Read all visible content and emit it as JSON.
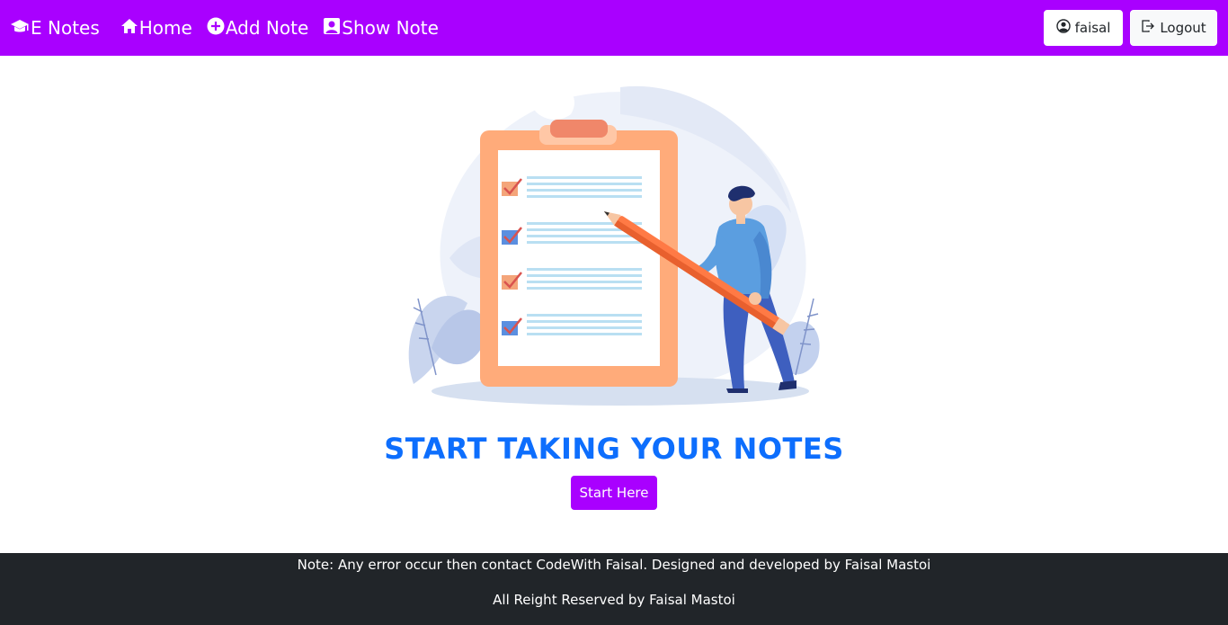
{
  "navbar": {
    "brand": "E Notes",
    "links": [
      {
        "label": "Home",
        "icon": "home-icon"
      },
      {
        "label": "Add Note",
        "icon": "plus-circle-icon"
      },
      {
        "label": "Show Note",
        "icon": "user-square-icon"
      }
    ],
    "user_button": {
      "label": "faisal",
      "icon": "user-circle-icon"
    },
    "logout_button": {
      "label": "Logout",
      "icon": "logout-icon"
    }
  },
  "hero": {
    "title": "START TAKING YOUR NOTES",
    "button": "Start Here",
    "illustration": "clipboard-checklist-with-person-holding-pencil"
  },
  "footer": {
    "line1": "Note: Any error occur then contact CodeWith Faisal. Designed and developed by Faisal Mastoi",
    "line2": "All Reight Reserved by Faisal Mastoi"
  },
  "colors": {
    "navbar": "#a900ff",
    "title": "#0d6efd",
    "footer": "#212529",
    "clipboard": "#ffab7a",
    "person_shirt": "#5b9ee0"
  }
}
